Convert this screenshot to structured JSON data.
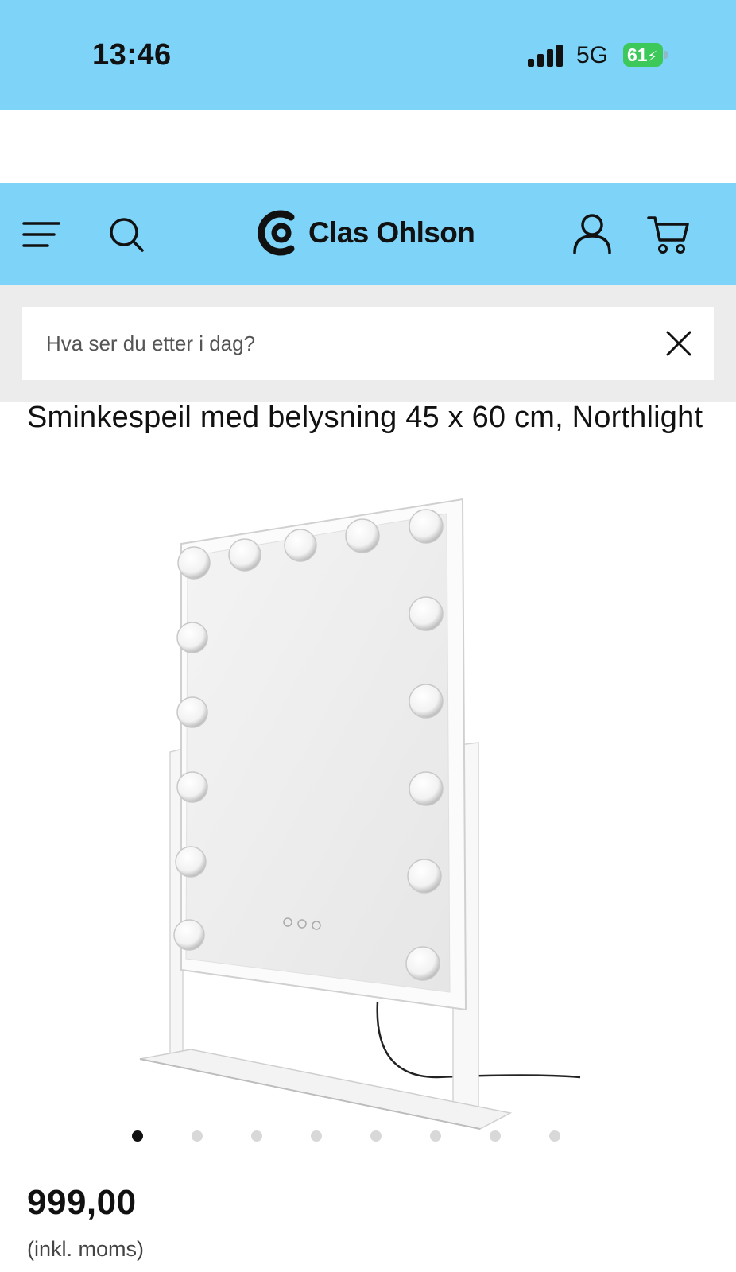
{
  "status_bar": {
    "time": "13:46",
    "network": "5G",
    "battery": "61"
  },
  "header": {
    "brand": "Clas Ohlson",
    "icons": [
      "menu-icon",
      "search-icon",
      "clas-ohlson-logo",
      "account-icon",
      "cart-icon"
    ]
  },
  "search": {
    "placeholder": "Hva ser du etter i dag?",
    "value": ""
  },
  "product": {
    "title": "Sminkespeil med belysning 45 x 60 cm, Northlight",
    "price": "999,00",
    "price_note": "(inkl. moms)",
    "carousel": {
      "total": 8,
      "active": 1
    }
  },
  "colors": {
    "header_bg": "#7dd3f8",
    "search_band_bg": "#ececec",
    "battery_green": "#3cc95a"
  }
}
